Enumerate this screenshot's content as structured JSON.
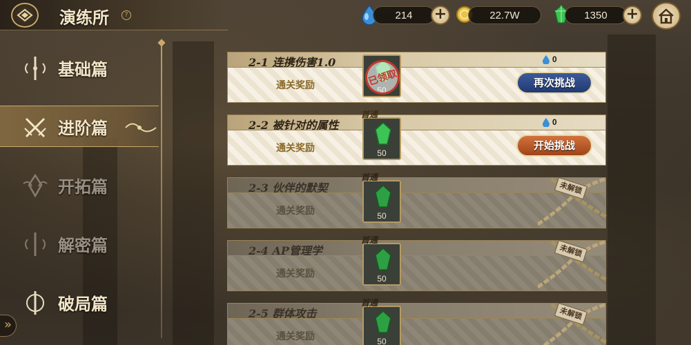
{
  "header": {
    "title": "演练所",
    "help": "?",
    "currencies": [
      {
        "name": "drop",
        "icon": "blue-drop-icon",
        "value": "214"
      },
      {
        "name": "gold",
        "icon": "gold-coin-icon",
        "value": "22.7W"
      },
      {
        "name": "gem",
        "icon": "green-gem-icon",
        "value": "1350"
      }
    ],
    "plus": "+"
  },
  "sidebar": {
    "items": [
      {
        "label": "基础篇",
        "state": "normal"
      },
      {
        "label": "进阶篇",
        "state": "active"
      },
      {
        "label": "开拓篇",
        "state": "locked"
      },
      {
        "label": "解密篇",
        "state": "locked"
      },
      {
        "label": "破局篇",
        "state": "normal"
      }
    ],
    "expand": "»"
  },
  "stages": [
    {
      "title": "2-1 连携伤害1.0",
      "reward_label": "通关奖励",
      "reward_count": "50",
      "first_clear": "",
      "claimed": "已领取",
      "cost": "0",
      "button": "再次挑战",
      "state": "cleared"
    },
    {
      "title": "2-2 被针对的属性",
      "reward_label": "通关奖励",
      "reward_count": "50",
      "first_clear": "首通",
      "claimed": "",
      "cost": "0",
      "button": "开始挑战",
      "state": "available"
    },
    {
      "title": "2-3 伙伴的默契",
      "reward_label": "通关奖励",
      "reward_count": "50",
      "first_clear": "首通",
      "claimed": "",
      "cost": "",
      "button": "",
      "locked_tag": "未解锁",
      "state": "locked"
    },
    {
      "title": "2-4 AP管理学",
      "reward_label": "通关奖励",
      "reward_count": "50",
      "first_clear": "首通",
      "claimed": "",
      "cost": "",
      "button": "",
      "locked_tag": "未解锁",
      "state": "locked"
    },
    {
      "title": "2-5 群体攻击",
      "reward_label": "通关奖励",
      "reward_count": "50",
      "first_clear": "首通",
      "claimed": "",
      "cost": "",
      "button": "",
      "locked_tag": "未解锁",
      "state": "locked"
    }
  ],
  "colors": {
    "accent": "#c9a96a",
    "retry": "#2b4684",
    "start": "#c05a28",
    "stamp": "#c0392b"
  }
}
